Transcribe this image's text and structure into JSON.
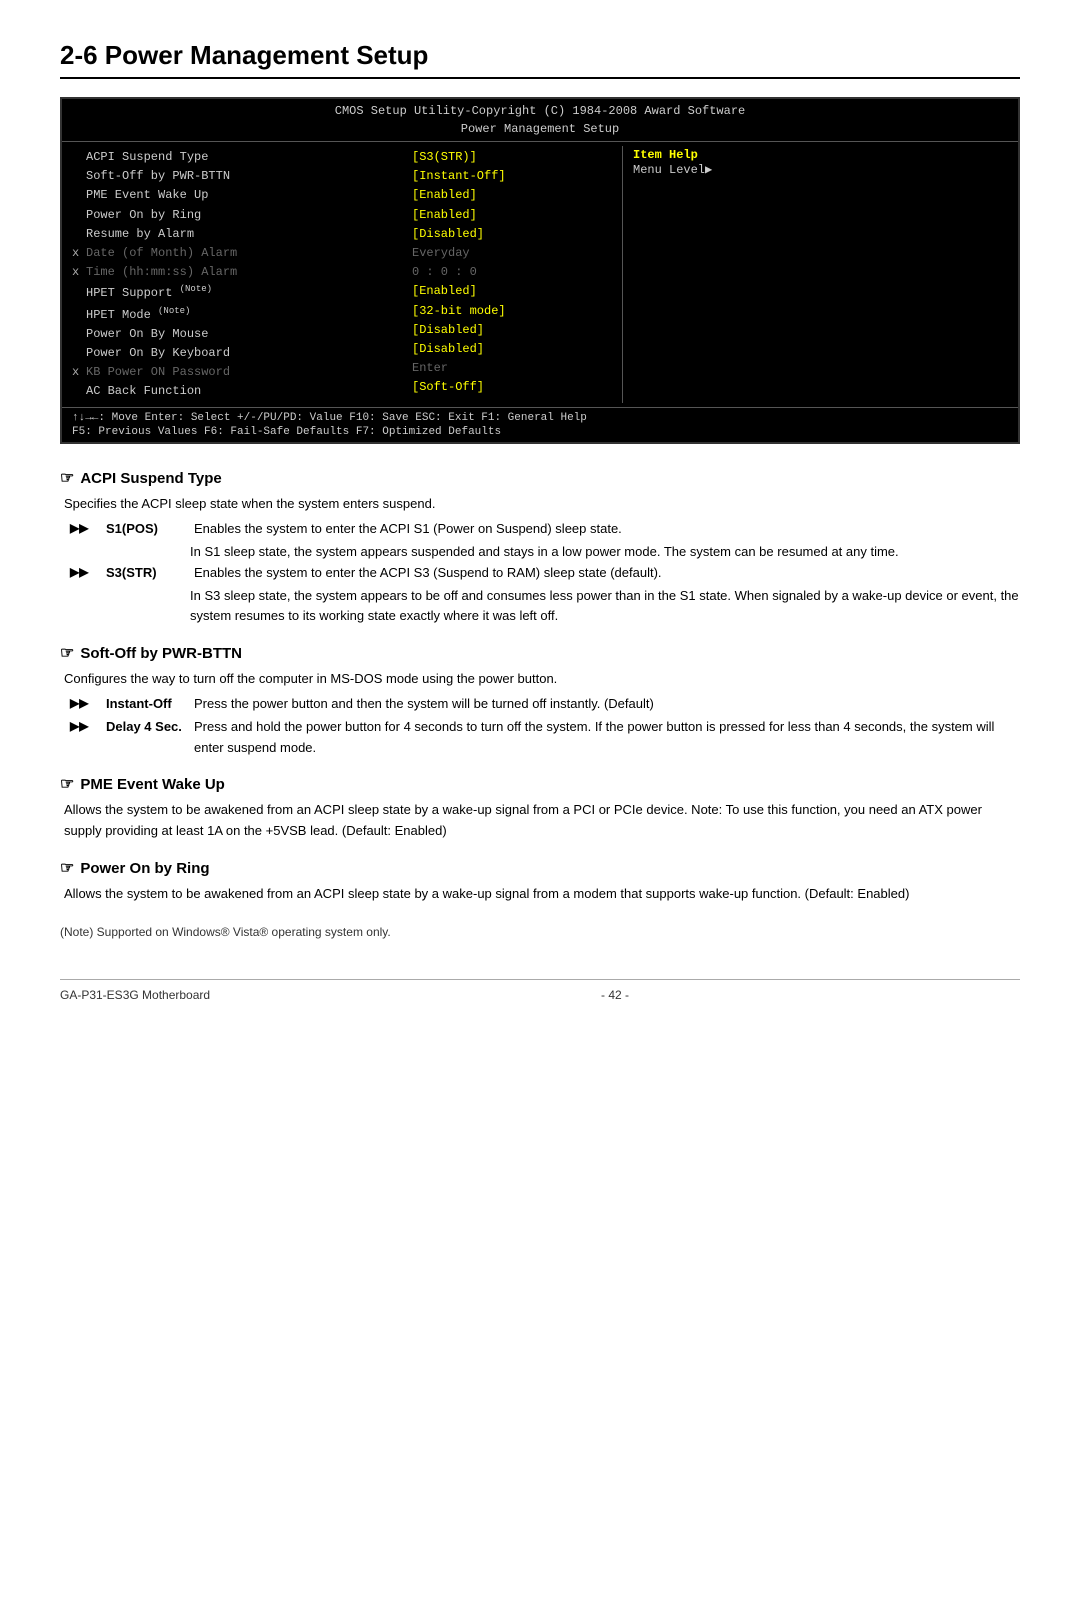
{
  "page": {
    "title": "2-6  Power Management Setup",
    "footer_left": "GA-P31-ES3G Motherboard",
    "footer_center": "- 42 -",
    "note": "(Note)   Supported on Windows® Vista® operating system only."
  },
  "bios": {
    "header1": "CMOS Setup Utility-Copyright (C) 1984-2008 Award Software",
    "header2": "Power Management Setup",
    "rows": [
      {
        "x": "",
        "label": "ACPI Suspend Type",
        "value": "[S3(STR)]",
        "dimmed": false
      },
      {
        "x": "",
        "label": "Soft-Off by PWR-BTTN",
        "value": "[Instant-Off]",
        "dimmed": false
      },
      {
        "x": "",
        "label": "PME Event Wake Up",
        "value": "[Enabled]",
        "dimmed": false
      },
      {
        "x": "",
        "label": "Power On by Ring",
        "value": "[Enabled]",
        "dimmed": false
      },
      {
        "x": "",
        "label": "Resume by Alarm",
        "value": "[Disabled]",
        "dimmed": false
      },
      {
        "x": "x",
        "label": "Date (of Month) Alarm",
        "value": "Everyday",
        "dimmed": true
      },
      {
        "x": "x",
        "label": "Time (hh:mm:ss) Alarm",
        "value": "0 : 0 : 0",
        "dimmed": true
      },
      {
        "x": "",
        "label": "HPET Support (Note)",
        "value": "[Enabled]",
        "dimmed": false
      },
      {
        "x": "",
        "label": "HPET Mode (Note)",
        "value": "[32-bit mode]",
        "dimmed": false
      },
      {
        "x": "",
        "label": "Power On By Mouse",
        "value": "[Disabled]",
        "dimmed": false
      },
      {
        "x": "",
        "label": "Power On By Keyboard",
        "value": "[Disabled]",
        "dimmed": false
      },
      {
        "x": "x",
        "label": "KB Power ON Password",
        "value": "Enter",
        "dimmed": true
      },
      {
        "x": "",
        "label": "AC Back Function",
        "value": "[Soft-Off]",
        "dimmed": false
      }
    ],
    "help_title": "Item Help",
    "help_text": "Menu Level▶",
    "footer": {
      "line1_left": "↑↓→←: Move    Enter: Select    +/-/PU/PD: Value    F10: Save    ESC: Exit    F1: General Help",
      "line2_left": "F5: Previous Values         F6: Fail-Safe Defaults              F7: Optimized Defaults"
    }
  },
  "sections": [
    {
      "id": "acpi-suspend-type",
      "title": "ACPI Suspend Type",
      "desc": "Specifies the ACPI sleep state when the system enters suspend.",
      "sub_items": [
        {
          "arrow": "▶▶",
          "label": "S1(POS)",
          "desc": "Enables the system to enter the ACPI S1 (Power on Suspend) sleep state.",
          "continued": "In S1 sleep state, the system appears suspended and stays in a low power mode. The system can be resumed at any time."
        },
        {
          "arrow": "▶▶",
          "label": "S3(STR)",
          "desc": "Enables the system to enter the ACPI S3 (Suspend to RAM) sleep state (default).",
          "continued": "In S3 sleep state, the system appears to be off and consumes less power than in the S1 state. When signaled by a wake-up device or event, the system resumes to its working state exactly where it was left off."
        }
      ]
    },
    {
      "id": "soft-off-pwr-bttn",
      "title": "Soft-Off by PWR-BTTN",
      "desc": "Configures the way to turn off the computer in MS-DOS mode using the power button.",
      "sub_items": [
        {
          "arrow": "▶▶",
          "label": "Instant-Off",
          "desc": "Press the power button and then the system will be turned off instantly. (Default)",
          "continued": ""
        },
        {
          "arrow": "▶▶",
          "label": "Delay 4 Sec.",
          "desc": "Press and hold the power button for 4 seconds to turn off the system. If the power button is pressed for less than 4 seconds, the system will enter suspend mode.",
          "continued": ""
        }
      ]
    },
    {
      "id": "pme-event-wake-up",
      "title": "PME Event Wake Up",
      "desc": "Allows the system to be awakened from an ACPI sleep state by a wake-up signal from a PCI or PCIe device. Note: To use this function, you need an ATX power supply providing at least 1A on the +5VSB lead. (Default: Enabled)",
      "sub_items": []
    },
    {
      "id": "power-on-by-ring",
      "title": "Power On by Ring",
      "desc": "Allows the system to be awakened from an ACPI sleep state by a wake-up signal from a modem that supports wake-up function. (Default: Enabled)",
      "sub_items": []
    }
  ]
}
